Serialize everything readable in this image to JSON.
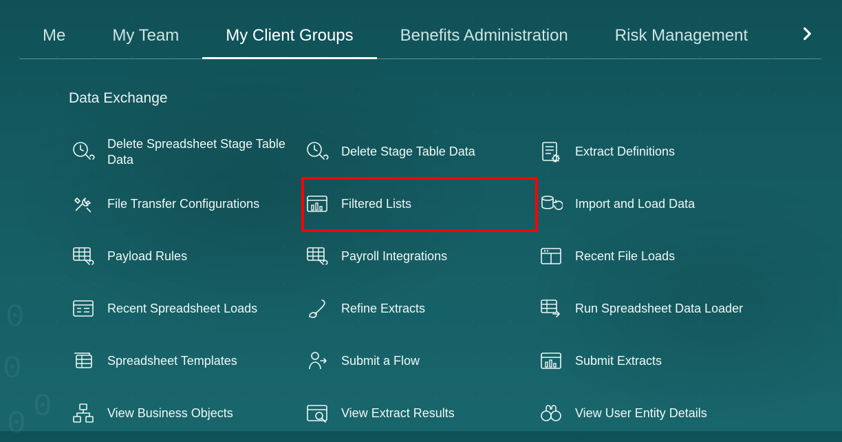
{
  "tabs": [
    {
      "label": "Me",
      "active": false
    },
    {
      "label": "My Team",
      "active": false
    },
    {
      "label": "My Client Groups",
      "active": true
    },
    {
      "label": "Benefits Administration",
      "active": false
    },
    {
      "label": "Risk Management",
      "active": false
    }
  ],
  "section_title": "Data Exchange",
  "tiles": [
    {
      "label": "Delete Spreadsheet Stage Table Data",
      "icon": "clock-wrench",
      "highlight": false
    },
    {
      "label": "Delete Stage Table Data",
      "icon": "clock-wrench",
      "highlight": false
    },
    {
      "label": "Extract Definitions",
      "icon": "doc-gear",
      "highlight": false
    },
    {
      "label": "File Transfer Configurations",
      "icon": "tools",
      "highlight": false
    },
    {
      "label": "Filtered Lists",
      "icon": "window-chart",
      "highlight": true
    },
    {
      "label": "Import and Load Data",
      "icon": "db-refresh",
      "highlight": false
    },
    {
      "label": "Payload Rules",
      "icon": "grid-wrench",
      "highlight": false
    },
    {
      "label": "Payroll Integrations",
      "icon": "grid-wrench",
      "highlight": false
    },
    {
      "label": "Recent File Loads",
      "icon": "window-panes",
      "highlight": false
    },
    {
      "label": "Recent Spreadsheet Loads",
      "icon": "window-grid",
      "highlight": false
    },
    {
      "label": "Refine Extracts",
      "icon": "brush",
      "highlight": false
    },
    {
      "label": "Run Spreadsheet Data Loader",
      "icon": "sheet-arrow",
      "highlight": false
    },
    {
      "label": "Spreadsheet Templates",
      "icon": "stack-grid",
      "highlight": false
    },
    {
      "label": "Submit a Flow",
      "icon": "person-arrow",
      "highlight": false
    },
    {
      "label": "Submit Extracts",
      "icon": "window-chart",
      "highlight": false
    },
    {
      "label": "View Business Objects",
      "icon": "hierarchy",
      "highlight": false
    },
    {
      "label": "View Extract Results",
      "icon": "window-search",
      "highlight": false
    },
    {
      "label": "View User Entity Details",
      "icon": "binoculars",
      "highlight": false
    }
  ]
}
